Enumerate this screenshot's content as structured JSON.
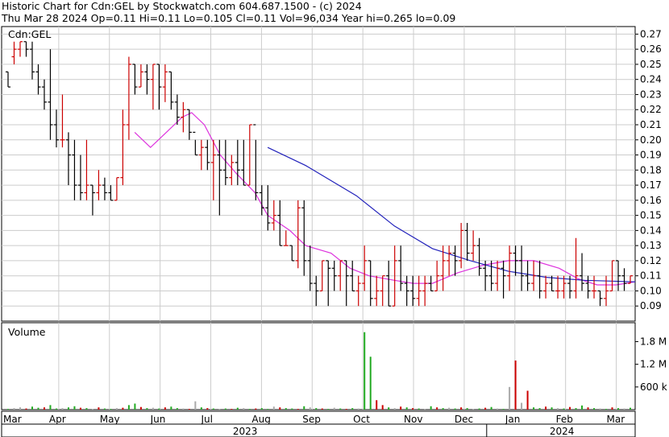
{
  "header": {
    "line1": "Historic Chart for Cdn:GEL by Stockwatch.com 604.687.1500 - (c) 2024",
    "line2": "Thu Mar 28 2024  Op=0.11  Hi=0.11  Lo=0.105  Cl=0.11  Vol=96,034  Year hi=0.265  lo=0.09"
  },
  "colors": {
    "up": "#cc0000",
    "down": "#000000",
    "ma_short": "#dd33dd",
    "ma_long": "#2222bb",
    "vol_up": "#22aa22",
    "vol_down": "#cc0000",
    "vol_flat": "#aaaaaa",
    "grid": "#cccccc"
  },
  "chart_data": [
    {
      "type": "ohlc",
      "symbol_label": "Cdn:GEL",
      "ylim": [
        0.08,
        0.275
      ],
      "y_ticks": [
        0.09,
        0.1,
        0.11,
        0.12,
        0.13,
        0.14,
        0.15,
        0.16,
        0.17,
        0.18,
        0.19,
        0.2,
        0.21,
        0.22,
        0.23,
        0.24,
        0.25,
        0.26,
        0.27
      ],
      "y_tick_labels": [
        "0.09",
        "0.10",
        "0.11",
        "0.12",
        "0.13",
        "0.14",
        "0.15",
        "0.16",
        "0.17",
        "0.18",
        "0.19",
        "0.20",
        "0.21",
        "0.22",
        "0.23",
        "0.24",
        "0.25",
        "0.26",
        "0.27"
      ],
      "x_labels": [
        "Mar",
        "Apr",
        "May",
        "Jun",
        "Jul",
        "Aug",
        "Sep",
        "Oct",
        "Nov",
        "Dec",
        "Jan",
        "Feb",
        "Mar"
      ],
      "year_labels": [
        "2023",
        "2024"
      ],
      "ohlc": [
        [
          0.245,
          0.245,
          0.235,
          0.235
        ],
        [
          0.255,
          0.265,
          0.25,
          0.26
        ],
        [
          0.26,
          0.265,
          0.255,
          0.265
        ],
        [
          0.265,
          0.265,
          0.255,
          0.26
        ],
        [
          0.26,
          0.265,
          0.24,
          0.245
        ],
        [
          0.245,
          0.25,
          0.23,
          0.235
        ],
        [
          0.235,
          0.24,
          0.22,
          0.225
        ],
        [
          0.225,
          0.26,
          0.2,
          0.21
        ],
        [
          0.21,
          0.22,
          0.195,
          0.2
        ],
        [
          0.2,
          0.23,
          0.195,
          0.2
        ],
        [
          0.2,
          0.205,
          0.17,
          0.19
        ],
        [
          0.19,
          0.2,
          0.16,
          0.17
        ],
        [
          0.17,
          0.19,
          0.16,
          0.165
        ],
        [
          0.165,
          0.2,
          0.16,
          0.17
        ],
        [
          0.17,
          0.17,
          0.15,
          0.165
        ],
        [
          0.165,
          0.18,
          0.16,
          0.17
        ],
        [
          0.17,
          0.175,
          0.16,
          0.165
        ],
        [
          0.165,
          0.17,
          0.16,
          0.16
        ],
        [
          0.16,
          0.175,
          0.16,
          0.175
        ],
        [
          0.175,
          0.22,
          0.17,
          0.21
        ],
        [
          0.21,
          0.255,
          0.2,
          0.25
        ],
        [
          0.25,
          0.25,
          0.23,
          0.235
        ],
        [
          0.235,
          0.25,
          0.235,
          0.245
        ],
        [
          0.245,
          0.25,
          0.23,
          0.24
        ],
        [
          0.24,
          0.25,
          0.22,
          0.25
        ],
        [
          0.25,
          0.25,
          0.22,
          0.235
        ],
        [
          0.235,
          0.25,
          0.225,
          0.245
        ],
        [
          0.245,
          0.245,
          0.22,
          0.225
        ],
        [
          0.225,
          0.23,
          0.21,
          0.215
        ],
        [
          0.215,
          0.225,
          0.205,
          0.22
        ],
        [
          0.22,
          0.22,
          0.2,
          0.205
        ],
        [
          0.205,
          0.2,
          0.19,
          0.19
        ],
        [
          0.19,
          0.2,
          0.18,
          0.195
        ],
        [
          0.195,
          0.2,
          0.18,
          0.185
        ],
        [
          0.185,
          0.2,
          0.16,
          0.19
        ],
        [
          0.19,
          0.2,
          0.15,
          0.18
        ],
        [
          0.18,
          0.2,
          0.17,
          0.175
        ],
        [
          0.175,
          0.19,
          0.17,
          0.185
        ],
        [
          0.185,
          0.2,
          0.17,
          0.18
        ],
        [
          0.18,
          0.2,
          0.17,
          0.17
        ],
        [
          0.17,
          0.21,
          0.17,
          0.21
        ],
        [
          0.21,
          0.2,
          0.16,
          0.165
        ],
        [
          0.165,
          0.17,
          0.15,
          0.155
        ],
        [
          0.155,
          0.17,
          0.14,
          0.145
        ],
        [
          0.145,
          0.16,
          0.14,
          0.15
        ],
        [
          0.15,
          0.16,
          0.13,
          0.13
        ],
        [
          0.13,
          0.14,
          0.13,
          0.13
        ],
        [
          0.13,
          0.13,
          0.12,
          0.12
        ],
        [
          0.12,
          0.16,
          0.115,
          0.155
        ],
        [
          0.155,
          0.16,
          0.11,
          0.12
        ],
        [
          0.12,
          0.13,
          0.1,
          0.105
        ],
        [
          0.105,
          0.11,
          0.09,
          0.1
        ],
        [
          0.1,
          0.12,
          0.1,
          0.12
        ],
        [
          0.12,
          0.12,
          0.09,
          0.115
        ],
        [
          0.115,
          0.12,
          0.1,
          0.11
        ],
        [
          0.11,
          0.12,
          0.1,
          0.12
        ],
        [
          0.12,
          0.12,
          0.09,
          0.11
        ],
        [
          0.11,
          0.12,
          0.1,
          0.1
        ],
        [
          0.1,
          0.11,
          0.09,
          0.105
        ],
        [
          0.105,
          0.13,
          0.1,
          0.12
        ],
        [
          0.12,
          0.12,
          0.09,
          0.095
        ],
        [
          0.095,
          0.11,
          0.09,
          0.1
        ],
        [
          0.1,
          0.11,
          0.09,
          0.11
        ],
        [
          0.11,
          0.12,
          0.09,
          0.09
        ],
        [
          0.09,
          0.13,
          0.09,
          0.12
        ],
        [
          0.12,
          0.13,
          0.1,
          0.105
        ],
        [
          0.105,
          0.11,
          0.09,
          0.1
        ],
        [
          0.1,
          0.11,
          0.09,
          0.095
        ],
        [
          0.095,
          0.11,
          0.09,
          0.1
        ],
        [
          0.1,
          0.11,
          0.09,
          0.105
        ],
        [
          0.105,
          0.11,
          0.1,
          0.1
        ],
        [
          0.1,
          0.12,
          0.1,
          0.11
        ],
        [
          0.11,
          0.13,
          0.1,
          0.12
        ],
        [
          0.12,
          0.13,
          0.11,
          0.125
        ],
        [
          0.125,
          0.13,
          0.11,
          0.12
        ],
        [
          0.12,
          0.145,
          0.115,
          0.14
        ],
        [
          0.14,
          0.145,
          0.12,
          0.125
        ],
        [
          0.125,
          0.14,
          0.12,
          0.13
        ],
        [
          0.13,
          0.135,
          0.11,
          0.115
        ],
        [
          0.115,
          0.12,
          0.1,
          0.11
        ],
        [
          0.11,
          0.12,
          0.1,
          0.105
        ],
        [
          0.105,
          0.12,
          0.1,
          0.115
        ],
        [
          0.115,
          0.12,
          0.095,
          0.11
        ],
        [
          0.11,
          0.13,
          0.1,
          0.125
        ],
        [
          0.125,
          0.13,
          0.11,
          0.12
        ],
        [
          0.12,
          0.13,
          0.1,
          0.11
        ],
        [
          0.11,
          0.12,
          0.1,
          0.105
        ],
        [
          0.105,
          0.12,
          0.1,
          0.11
        ],
        [
          0.11,
          0.12,
          0.095,
          0.1
        ],
        [
          0.1,
          0.11,
          0.095,
          0.105
        ],
        [
          0.105,
          0.11,
          0.1,
          0.1
        ],
        [
          0.1,
          0.11,
          0.095,
          0.1
        ],
        [
          0.1,
          0.11,
          0.095,
          0.105
        ],
        [
          0.105,
          0.11,
          0.095,
          0.1
        ],
        [
          0.1,
          0.135,
          0.095,
          0.11
        ],
        [
          0.11,
          0.125,
          0.1,
          0.105
        ],
        [
          0.105,
          0.11,
          0.095,
          0.1
        ],
        [
          0.1,
          0.11,
          0.095,
          0.1
        ],
        [
          0.1,
          0.1,
          0.09,
          0.095
        ],
        [
          0.095,
          0.11,
          0.09,
          0.1
        ],
        [
          0.1,
          0.12,
          0.1,
          0.12
        ],
        [
          0.12,
          0.12,
          0.1,
          0.11
        ],
        [
          0.11,
          0.115,
          0.1,
          0.105
        ],
        [
          0.105,
          0.11,
          0.105,
          0.11
        ]
      ],
      "ma_short": [
        [
          0.21,
          0.205
        ],
        [
          0.235,
          0.195
        ],
        [
          0.26,
          0.205
        ],
        [
          0.285,
          0.215
        ],
        [
          0.3,
          0.218
        ],
        [
          0.32,
          0.21
        ],
        [
          0.345,
          0.19
        ],
        [
          0.37,
          0.178
        ],
        [
          0.4,
          0.165
        ],
        [
          0.42,
          0.15
        ],
        [
          0.455,
          0.14
        ],
        [
          0.48,
          0.13
        ],
        [
          0.52,
          0.125
        ],
        [
          0.55,
          0.115
        ],
        [
          0.58,
          0.11
        ],
        [
          0.62,
          0.107
        ],
        [
          0.65,
          0.105
        ],
        [
          0.68,
          0.105
        ],
        [
          0.72,
          0.112
        ],
        [
          0.76,
          0.117
        ],
        [
          0.8,
          0.12
        ],
        [
          0.84,
          0.12
        ],
        [
          0.88,
          0.115
        ],
        [
          0.91,
          0.108
        ],
        [
          0.94,
          0.104
        ],
        [
          0.97,
          0.104
        ],
        [
          1.0,
          0.106
        ]
      ],
      "ma_long": [
        [
          0.42,
          0.195
        ],
        [
          0.48,
          0.183
        ],
        [
          0.56,
          0.163
        ],
        [
          0.62,
          0.143
        ],
        [
          0.68,
          0.128
        ],
        [
          0.74,
          0.12
        ],
        [
          0.8,
          0.113
        ],
        [
          0.86,
          0.109
        ],
        [
          0.92,
          0.107
        ],
        [
          1.0,
          0.106
        ]
      ]
    },
    {
      "type": "bar",
      "title": "Volume",
      "ylim": [
        0,
        2300000
      ],
      "y_ticks": [
        600000,
        1200000,
        1800000
      ],
      "y_tick_labels": [
        "600 k",
        "1.2 M",
        "1.8 M"
      ],
      "volumes": [
        20000,
        40000,
        60000,
        30000,
        80000,
        50000,
        60000,
        120000,
        30000,
        40000,
        60000,
        90000,
        50000,
        40000,
        20000,
        60000,
        30000,
        20000,
        40000,
        50000,
        120000,
        160000,
        70000,
        40000,
        50000,
        30000,
        60000,
        80000,
        40000,
        30000,
        20000,
        220000,
        60000,
        40000,
        30000,
        20000,
        30000,
        20000,
        50000,
        40000,
        20000,
        30000,
        40000,
        20000,
        80000,
        60000,
        40000,
        30000,
        20000,
        90000,
        60000,
        40000,
        30000,
        20000,
        50000,
        30000,
        20000,
        40000,
        30000,
        2050000,
        1400000,
        250000,
        120000,
        60000,
        40000,
        80000,
        60000,
        40000,
        30000,
        20000,
        90000,
        60000,
        40000,
        50000,
        30000,
        60000,
        40000,
        20000,
        30000,
        50000,
        70000,
        30000,
        20000,
        600000,
        1300000,
        180000,
        500000,
        60000,
        40000,
        80000,
        60000,
        40000,
        30000,
        70000,
        40000,
        110000,
        60000,
        40000,
        30000,
        20000,
        60000,
        40000,
        30000,
        50000
      ],
      "directions": [
        1,
        0,
        0,
        -1,
        1,
        1,
        -1,
        1,
        1,
        0,
        1,
        1,
        -1,
        1,
        0,
        -1,
        1,
        1,
        0,
        -1,
        1,
        1,
        -1,
        1,
        0,
        1,
        -1,
        1,
        1,
        0,
        -1,
        0,
        1,
        -1,
        1,
        0,
        1,
        -1,
        1,
        0,
        1,
        -1,
        1,
        1,
        0,
        -1,
        1,
        1,
        -1,
        1,
        0,
        1,
        -1,
        1,
        0,
        1,
        -1,
        1,
        0,
        1,
        1,
        -1,
        -1,
        1,
        0,
        -1,
        1,
        -1,
        1,
        0,
        1,
        -1,
        1,
        0,
        1,
        -1,
        1,
        0,
        1,
        -1,
        1,
        0,
        1,
        0,
        -1,
        0,
        -1,
        1,
        1,
        -1,
        1,
        0,
        1,
        -1,
        1,
        1,
        -1,
        1,
        0,
        1,
        -1,
        1,
        0,
        1
      ]
    }
  ]
}
